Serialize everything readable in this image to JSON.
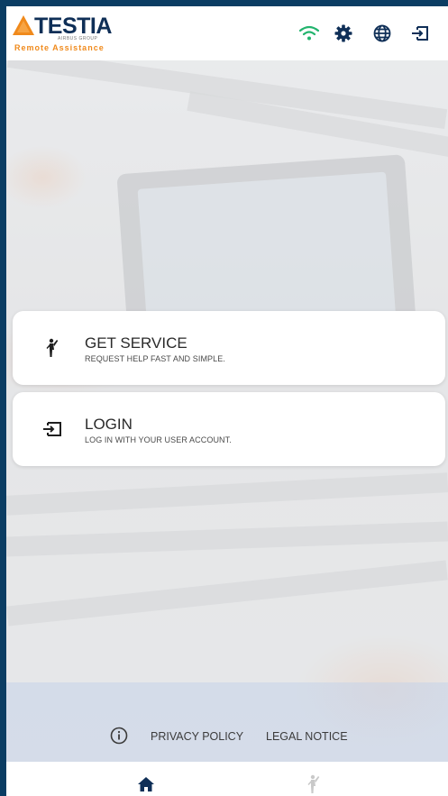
{
  "header": {
    "logo_text": "TESTIA",
    "logo_group_text": "AIRBUS GROUP",
    "logo_subtitle": "Remote Assistance",
    "icons": [
      "wifi-icon",
      "gear-icon",
      "globe-icon",
      "login-icon"
    ]
  },
  "cards": [
    {
      "title": "GET SERVICE",
      "subtitle": "REQUEST HELP FAST AND SIMPLE.",
      "icon": "person-waving-icon"
    },
    {
      "title": "LOGIN",
      "subtitle": "LOG IN WITH YOUR USER ACCOUNT.",
      "icon": "login-icon"
    }
  ],
  "footer": {
    "privacy_label": "PRIVACY POLICY",
    "legal_label": "LEGAL NOTICE"
  },
  "bottom_nav": {
    "items": [
      "home-icon",
      "person-waving-icon"
    ],
    "active": "home-icon"
  },
  "colors": {
    "brand_navy": "#0f2f57",
    "brand_orange": "#f08a1c",
    "wifi_green": "#23b46e",
    "frame_blue": "#0b3d63"
  }
}
